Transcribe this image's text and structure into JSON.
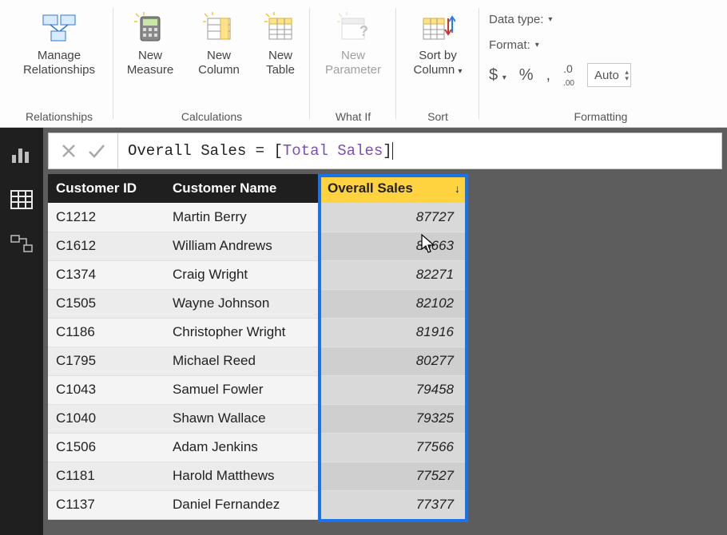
{
  "ribbon": {
    "relationships": {
      "manage": "Manage\nRelationships",
      "group": "Relationships"
    },
    "calculations": {
      "measure": "New\nMeasure",
      "column": "New\nColumn",
      "table": "New\nTable",
      "group": "Calculations"
    },
    "whatif": {
      "parameter": "New\nParameter",
      "group": "What If"
    },
    "sort": {
      "sortby": "Sort by\nColumn",
      "group": "Sort"
    },
    "formatting": {
      "datatype_label": "Data type:",
      "format_label": "Format:",
      "currency": "$",
      "percent": "%",
      "comma": ",",
      "precision": "Auto",
      "group": "Formatting"
    }
  },
  "formula": {
    "measure_name": "Overall Sales",
    "equals": " = ",
    "ref": "Total Sales"
  },
  "table": {
    "columns": {
      "id": "Customer ID",
      "name": "Customer Name",
      "sales": "Overall Sales"
    },
    "rows": [
      {
        "id": "C1212",
        "name": "Martin Berry",
        "sales": "87727"
      },
      {
        "id": "C1612",
        "name": "William Andrews",
        "sales": "86663"
      },
      {
        "id": "C1374",
        "name": "Craig Wright",
        "sales": "82271"
      },
      {
        "id": "C1505",
        "name": "Wayne Johnson",
        "sales": "82102"
      },
      {
        "id": "C1186",
        "name": "Christopher Wright",
        "sales": "81916"
      },
      {
        "id": "C1795",
        "name": "Michael Reed",
        "sales": "80277"
      },
      {
        "id": "C1043",
        "name": "Samuel Fowler",
        "sales": "79458"
      },
      {
        "id": "C1040",
        "name": "Shawn Wallace",
        "sales": "79325"
      },
      {
        "id": "C1506",
        "name": "Adam Jenkins",
        "sales": "77566"
      },
      {
        "id": "C1181",
        "name": "Harold Matthews",
        "sales": "77527"
      },
      {
        "id": "C1137",
        "name": "Daniel Fernandez",
        "sales": "77377"
      }
    ]
  }
}
